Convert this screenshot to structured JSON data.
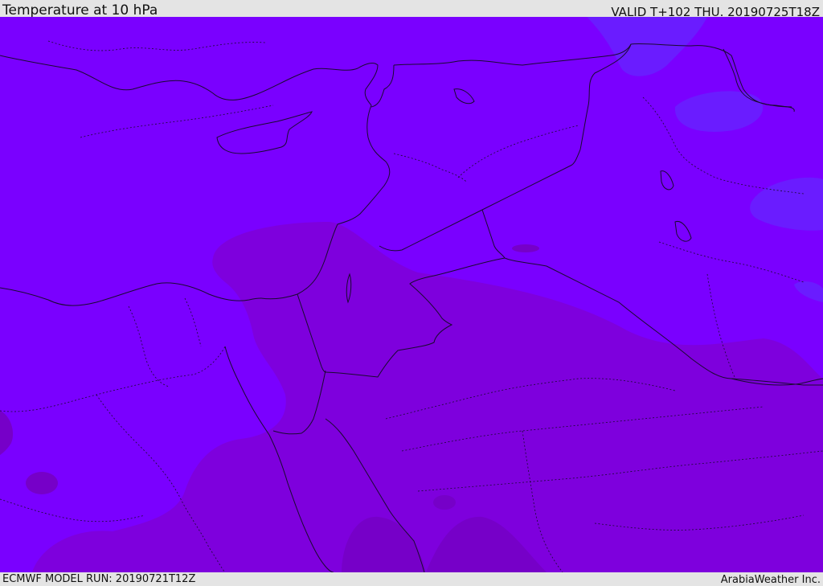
{
  "header": {
    "title": "Temperature at 10 hPa",
    "valid": "VALID T+102 THU. 20190725T18Z"
  },
  "footer": {
    "model_run": "ECMWF MODEL RUN: 20190721T12Z",
    "credit": "ArabiaWeather Inc."
  },
  "colors": {
    "field_main": "#7a00ff",
    "field_warm": "#7e00dd",
    "field_warmer": "#7600c8",
    "field_cool": "#6a1cff",
    "coastline": "#1a0a30"
  }
}
